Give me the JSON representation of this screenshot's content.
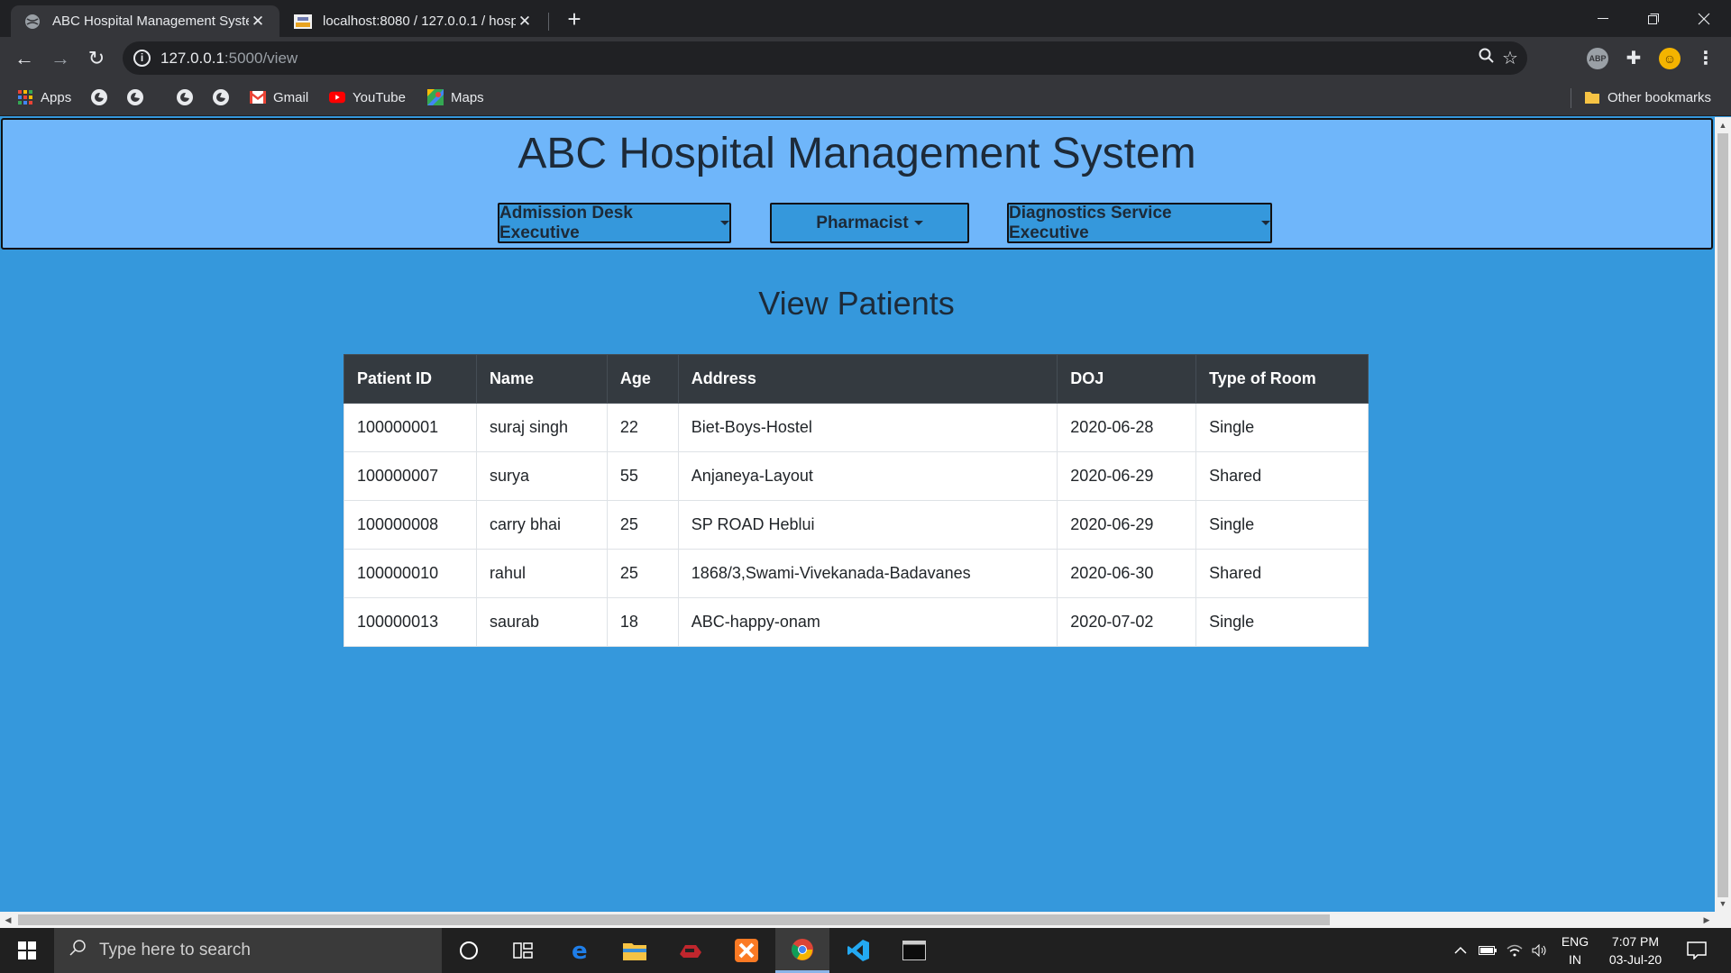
{
  "browser": {
    "tabs": [
      {
        "title": "ABC Hospital Management Syste",
        "active": true
      },
      {
        "title": "localhost:8080 / 127.0.0.1 / hospi",
        "active": false
      }
    ],
    "new_tab_label": "+",
    "url_host": "127.0.0.1",
    "url_path": ":5000/view",
    "bookmarks": {
      "apps": "Apps",
      "gmail": "Gmail",
      "youtube": "YouTube",
      "maps": "Maps",
      "other": "Other bookmarks"
    },
    "extension_badge": "ABP"
  },
  "app": {
    "title": "ABC Hospital Management System",
    "nav": [
      {
        "label": "Admission Desk Executive"
      },
      {
        "label": "Pharmacist"
      },
      {
        "label": "Diagnostics Service Executive"
      }
    ]
  },
  "view": {
    "title": "View Patients",
    "columns": [
      "Patient ID",
      "Name",
      "Age",
      "Address",
      "DOJ",
      "Type of Room"
    ],
    "rows": [
      [
        "100000001",
        "suraj singh",
        "22",
        "Biet-Boys-Hostel",
        "2020-06-28",
        "Single"
      ],
      [
        "100000007",
        "surya",
        "55",
        "Anjaneya-Layout",
        "2020-06-29",
        "Shared"
      ],
      [
        "100000008",
        "carry bhai",
        "25",
        "SP ROAD Heblui",
        "2020-06-29",
        "Single"
      ],
      [
        "100000010",
        "rahul",
        "25",
        "1868/3,Swami-Vivekanada-Badavanes",
        "2020-06-30",
        "Shared"
      ],
      [
        "100000013",
        "saurab",
        "18",
        "ABC-happy-onam",
        "2020-07-02",
        "Single"
      ]
    ]
  },
  "taskbar": {
    "search_placeholder": "Type here to search",
    "lang_top": "ENG",
    "lang_bottom": "IN",
    "time": "7:07 PM",
    "date": "03-Jul-20"
  },
  "colors": {
    "page_bg": "#3598dc",
    "header_bg": "#6fb6fa",
    "table_header_bg": "#343a40"
  }
}
